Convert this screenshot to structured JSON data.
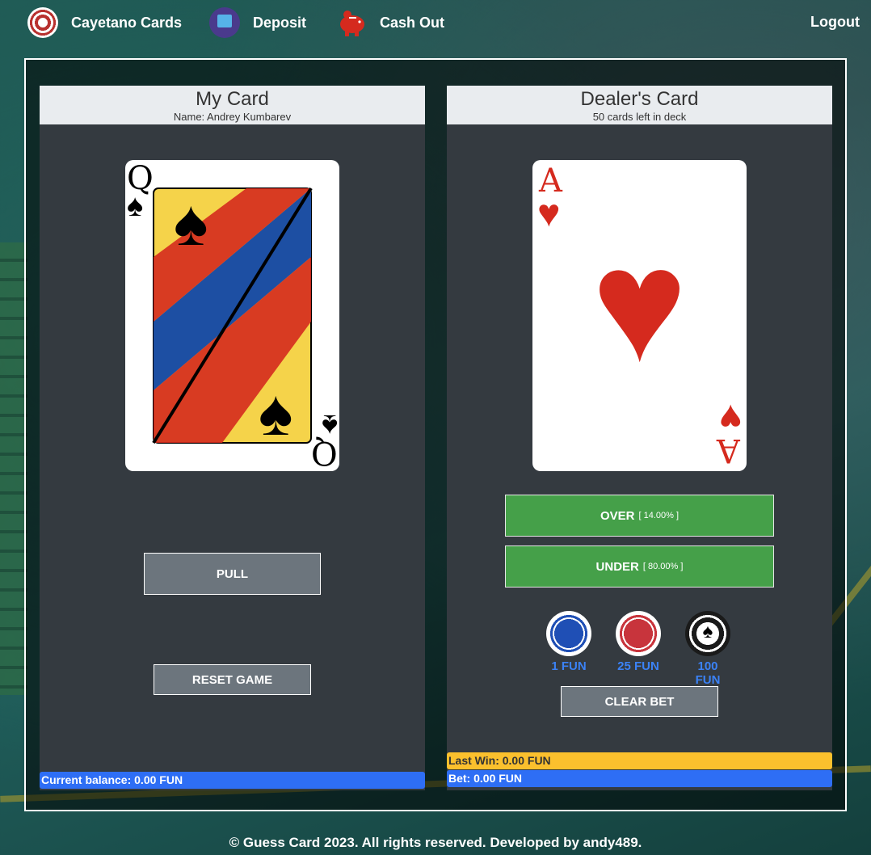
{
  "nav": {
    "brand_label": "Cayetano Cards",
    "deposit_label": "Deposit",
    "cashout_label": "Cash Out",
    "logout_label": "Logout"
  },
  "player": {
    "title": "My Card",
    "subtitle": "Name: Andrey Kumbarev",
    "card": {
      "rank": "Q",
      "suit": "♠",
      "color": "#000000"
    },
    "pull_label": "PULL",
    "reset_label": "RESET GAME",
    "balance_text": "Current balance: 0.00 FUN"
  },
  "dealer": {
    "title": "Dealer's Card",
    "subtitle": "50 cards left in deck",
    "card": {
      "rank": "A",
      "suit": "♥",
      "color": "#d52a1e"
    },
    "over_label": "OVER",
    "over_odds": "[ 14.00% ]",
    "under_label": "UNDER",
    "under_odds": "[ 80.00% ]",
    "chips": [
      {
        "label": "1 FUN",
        "color": "#1f4fb5"
      },
      {
        "label": "25 FUN",
        "color": "#c8343c"
      },
      {
        "label": "100 FUN",
        "color": "#1a1a1a"
      }
    ],
    "clear_label": "CLEAR BET",
    "last_win_text": "Last Win: 0.00 FUN",
    "bet_text": "Bet: 0.00 FUN"
  },
  "colors": {
    "accent_blue": "#2e6ef5",
    "accent_green": "#45a049",
    "accent_yellow": "#fbc02d"
  },
  "footer": {
    "text": "© Guess Card 2023. All rights reserved. Developed by andy489."
  }
}
